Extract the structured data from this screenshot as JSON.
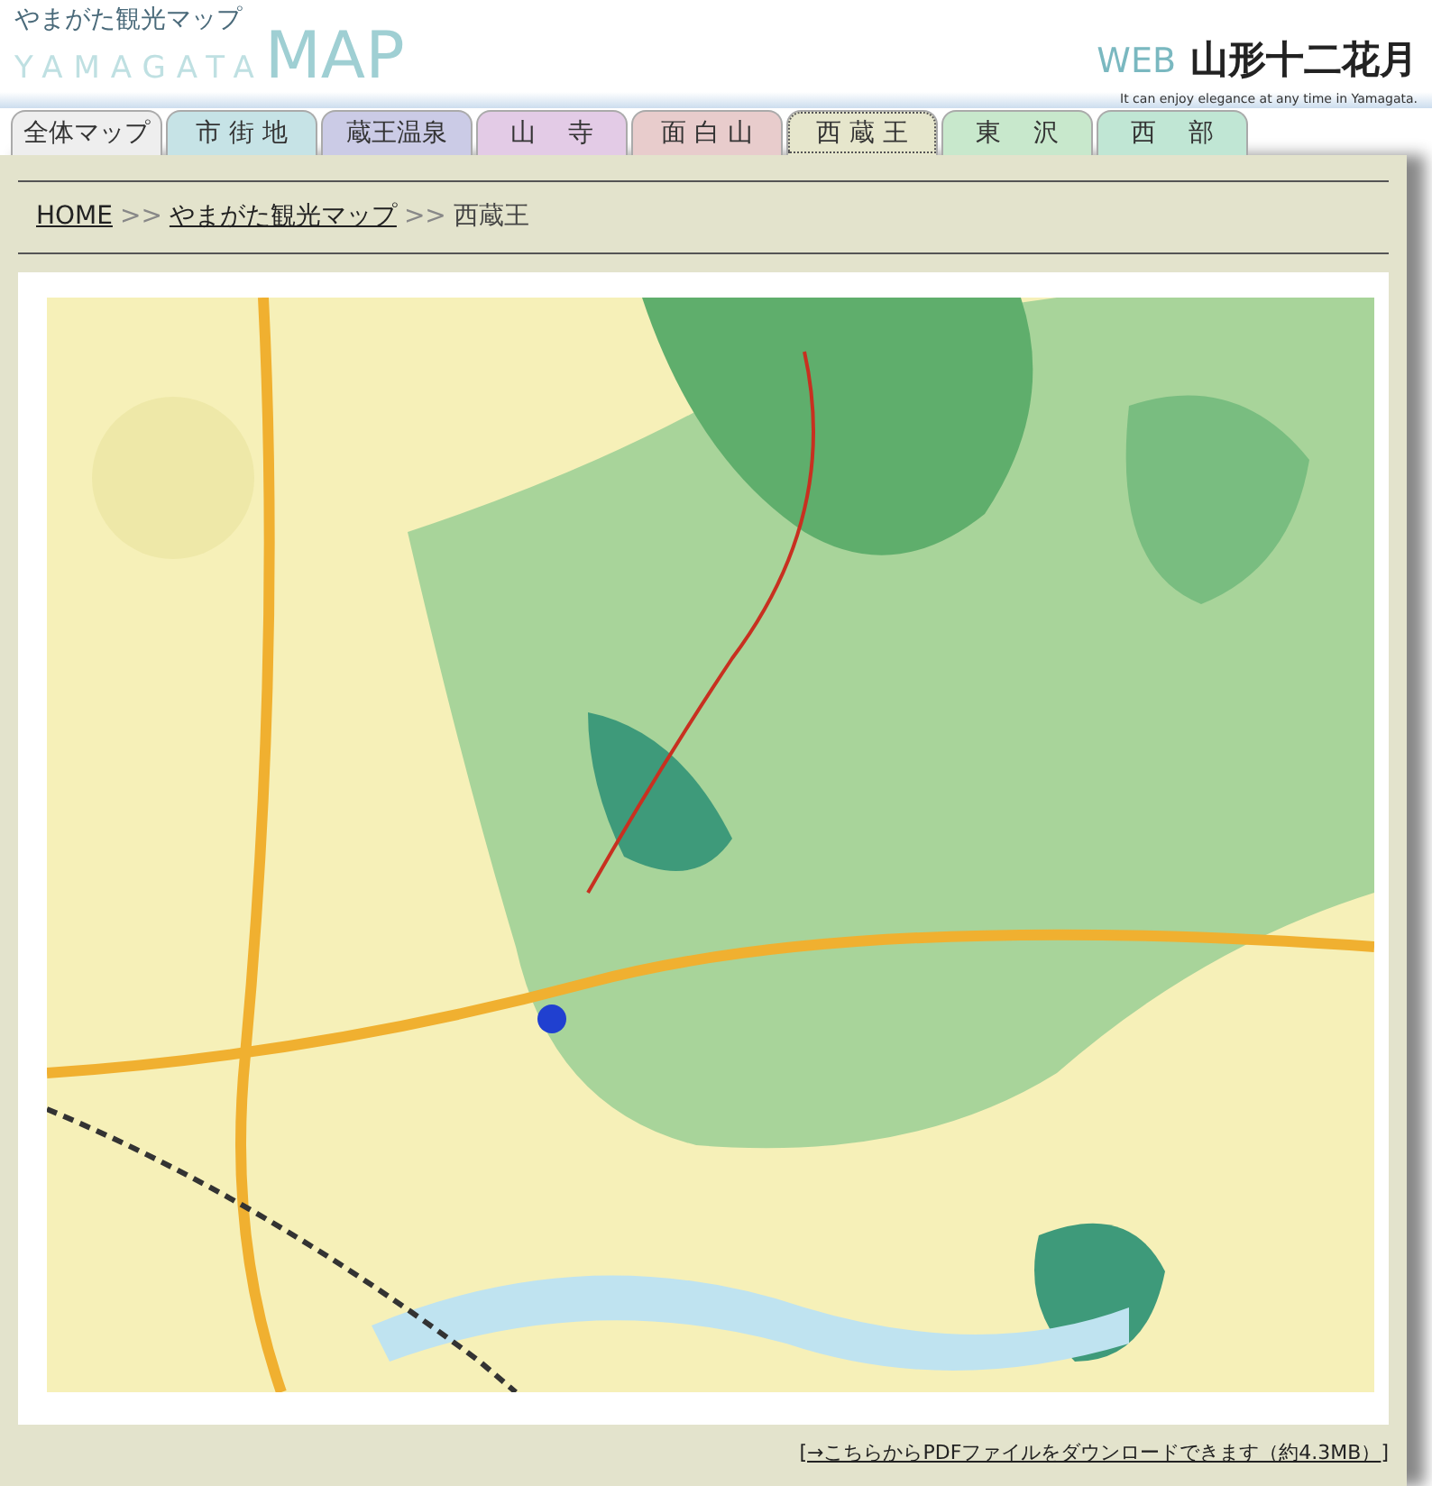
{
  "header": {
    "title": "やまがた観光マップ",
    "logo_text": "YAMAGATA",
    "logo_big": "MAP",
    "site_prefix": "WEB",
    "site_name": "山形十二花月",
    "tagline": "It can enjoy elegance at any time in Yamagata."
  },
  "tabs": [
    {
      "label": "全体マップ",
      "color": "#eeeeee",
      "selected": false
    },
    {
      "label": "市 街 地",
      "color": "#c6e3e6",
      "selected": false
    },
    {
      "label": "蔵王温泉",
      "color": "#cbcbe6",
      "selected": false
    },
    {
      "label": "山　 寺",
      "color": "#e3cbe6",
      "selected": false
    },
    {
      "label": "面 白 山",
      "color": "#e8cccc",
      "selected": false
    },
    {
      "label": "西 蔵 王",
      "color": "#e6e6cc",
      "selected": true
    },
    {
      "label": "東　 沢",
      "color": "#c8e8cc",
      "selected": false
    },
    {
      "label": "西　 部",
      "color": "#c0e6d4",
      "selected": false
    }
  ],
  "breadcrumb": [
    {
      "label": "HOME",
      "link": true
    },
    {
      "label": "やまがた観光マップ",
      "link": true
    },
    {
      "label": "西蔵王",
      "link": false
    }
  ],
  "breadcrumb_separator": ">>",
  "map": {
    "kind": "picture"
  },
  "download_link": "→こちらからPDFファイルをダウンロードできます（約4.3MB）",
  "download_brackets": [
    "[",
    "]"
  ]
}
